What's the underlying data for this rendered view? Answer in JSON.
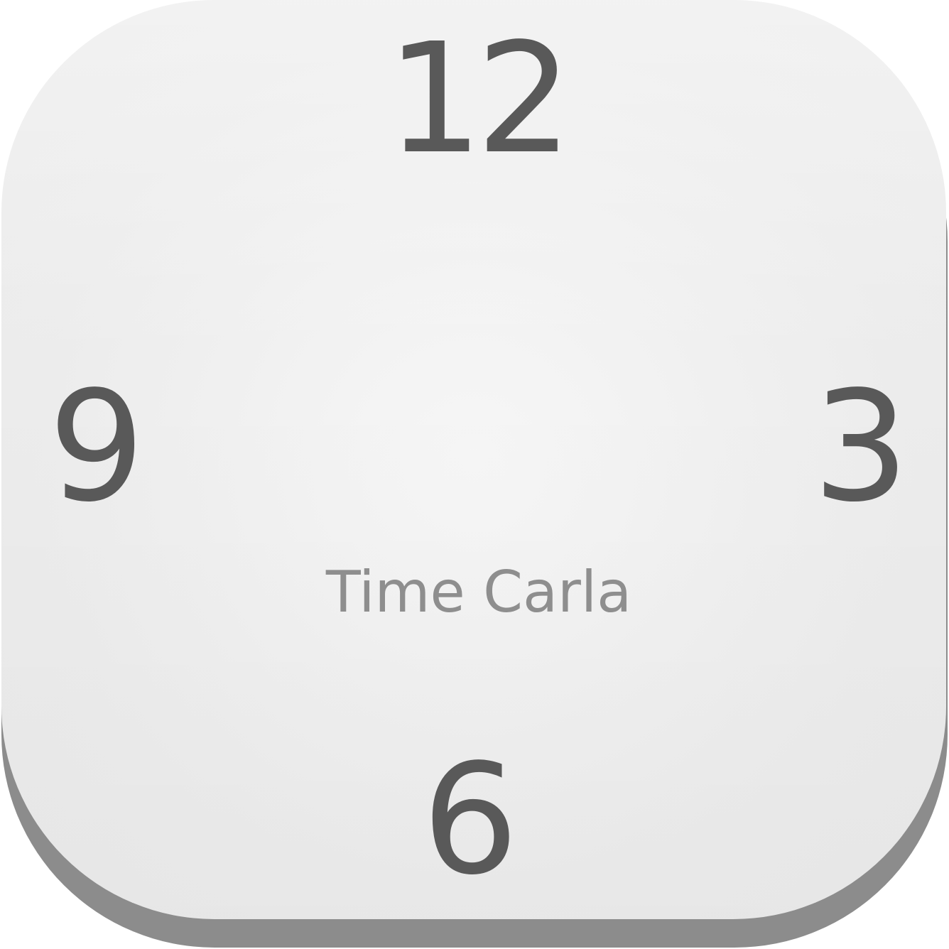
{
  "clock_face": {
    "numerals": {
      "twelve": "12",
      "three": "3",
      "six": "6",
      "nine": "9"
    },
    "app_name": "Time Carla"
  },
  "colors": {
    "numeral": "#595959",
    "app_name": "#8e8e8e",
    "face": "#efefef",
    "shadow": "#8c8c8c"
  },
  "icons": {
    "app_icon": "clock-icon"
  }
}
